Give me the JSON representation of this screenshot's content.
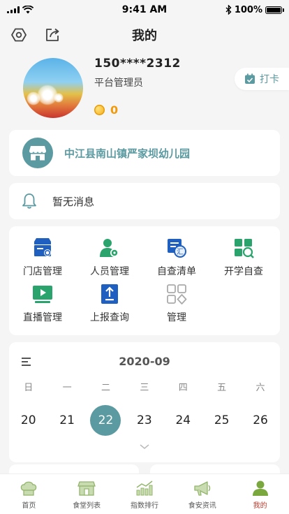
{
  "status_bar": {
    "time": "9:41 AM",
    "battery": "100%"
  },
  "nav": {
    "title": "我的"
  },
  "profile": {
    "phone": "150****2312",
    "role": "平台管理员",
    "coins": "0",
    "checkin_label": "打卡"
  },
  "school": {
    "name": "中江县南山镇严家坝幼儿园"
  },
  "messages": {
    "text": "暂无消息"
  },
  "features": [
    {
      "label": "门店管理",
      "icon": "store-settings-icon"
    },
    {
      "label": "人员管理",
      "icon": "user-settings-icon"
    },
    {
      "label": "自查清单",
      "icon": "checklist-icon"
    },
    {
      "label": "开学自查",
      "icon": "grid-search-icon"
    },
    {
      "label": "直播管理",
      "icon": "live-play-icon"
    },
    {
      "label": "上报查询",
      "icon": "upload-report-icon"
    },
    {
      "label": "管理",
      "icon": "apps-grid-icon"
    }
  ],
  "calendar": {
    "month": "2020-09",
    "weekdays": [
      "日",
      "一",
      "二",
      "三",
      "四",
      "五",
      "六"
    ],
    "days": [
      "20",
      "21",
      "22",
      "23",
      "24",
      "25",
      "26"
    ],
    "selected_day": "22"
  },
  "tabs": [
    {
      "label": "首页",
      "icon": "chef-hat-icon"
    },
    {
      "label": "食堂列表",
      "icon": "canteen-icon"
    },
    {
      "label": "指数排行",
      "icon": "trend-chart-icon"
    },
    {
      "label": "食安资讯",
      "icon": "megaphone-icon"
    },
    {
      "label": "我的",
      "icon": "user-icon",
      "active": true
    }
  ],
  "colors": {
    "primary": "#5a9aa0",
    "green": "#2aa36c",
    "blue": "#1e5fbf",
    "coin": "#f29a0d",
    "active_tab": "#c0392b"
  }
}
